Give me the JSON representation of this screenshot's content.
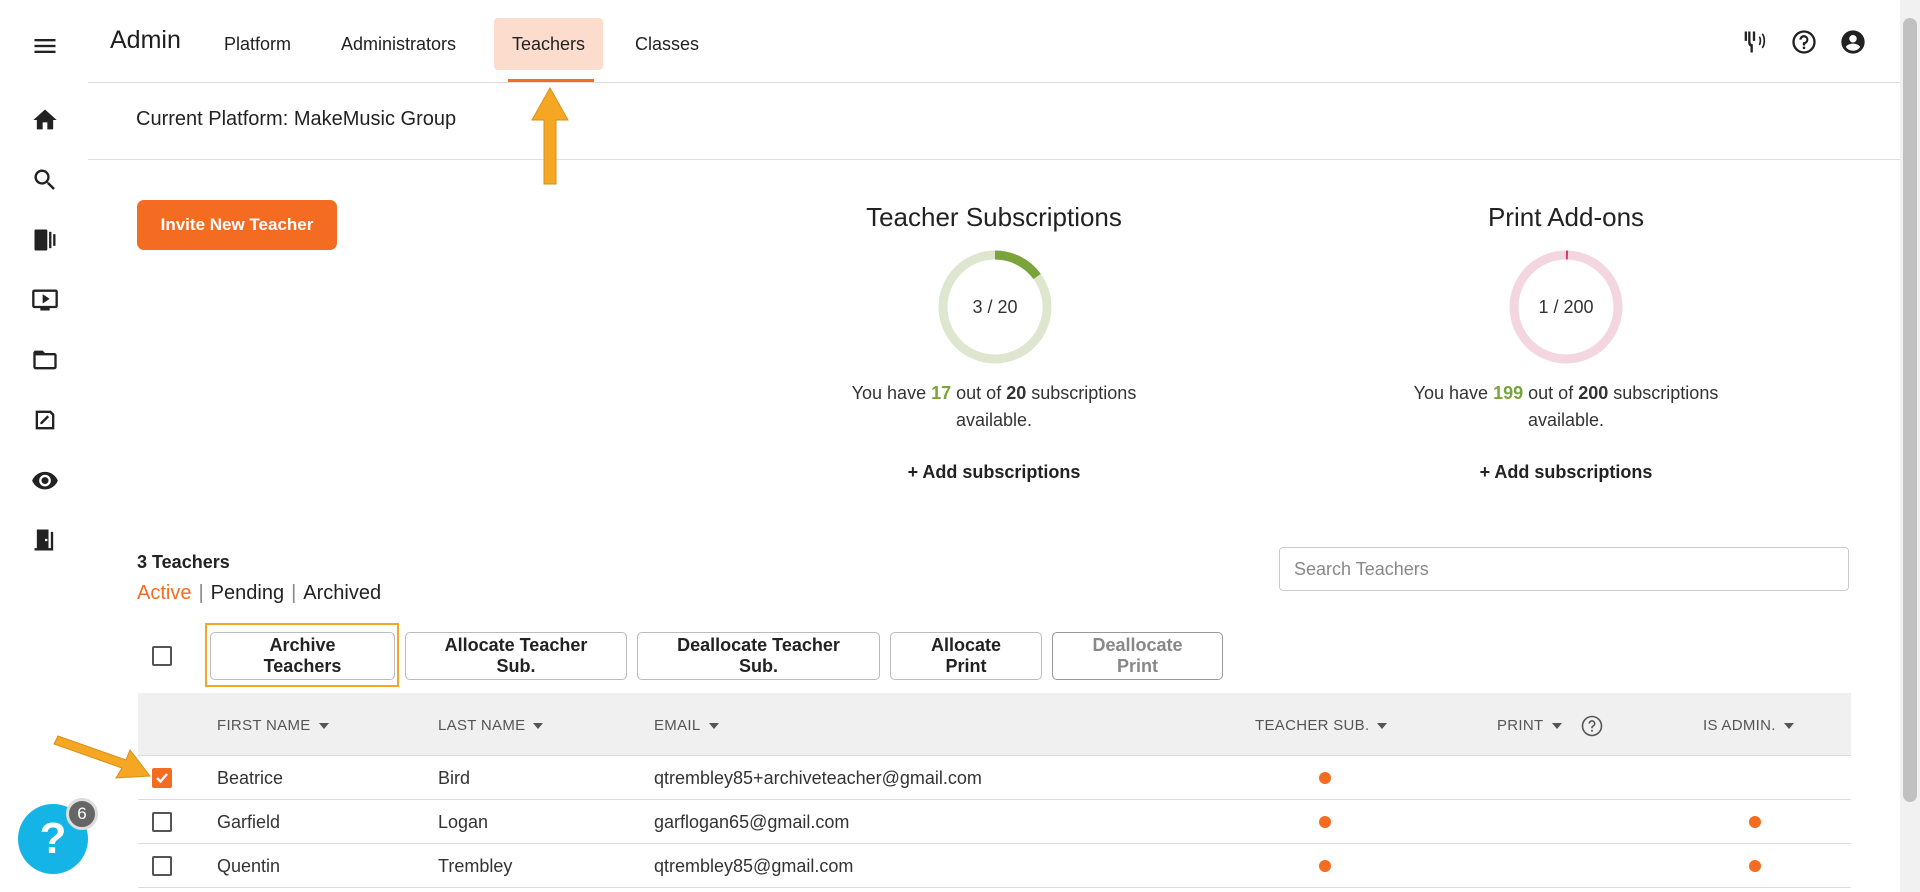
{
  "header": {
    "brand": "Admin",
    "nav": [
      {
        "label": "Platform"
      },
      {
        "label": "Administrators"
      },
      {
        "label": "Teachers",
        "active": true
      },
      {
        "label": "Classes"
      }
    ]
  },
  "platform": {
    "label": "Current Platform: MakeMusic Group"
  },
  "invite_label": "Invite New Teacher",
  "teacher_subscriptions": {
    "title": "Teacher Subscriptions",
    "ring_text": "3 / 20",
    "used": 3,
    "total": 20,
    "desc_prefix": "You have",
    "available": "17",
    "desc_mid": "out of",
    "total_text": "20",
    "desc_suffix": "subscriptions",
    "desc_line2": "available.",
    "add_label": "+ Add subscriptions",
    "color": "#7aa33c"
  },
  "print_addons": {
    "title": "Print Add-ons",
    "ring_text": "1 / 200",
    "used": 1,
    "total": 200,
    "desc_prefix": "You have",
    "available": "199",
    "desc_mid": "out of",
    "total_text": "200",
    "desc_suffix": "subscriptions",
    "desc_line2": "available.",
    "add_label": "+ Add subscriptions",
    "color": "#d63c6b"
  },
  "teachers": {
    "count_label": "3 Teachers",
    "filters": [
      "Active",
      "Pending",
      "Archived"
    ],
    "search_placeholder": "Search Teachers",
    "actions": [
      "Archive Teachers",
      "Allocate Teacher Sub.",
      "Deallocate Teacher Sub.",
      "Allocate Print",
      "Deallocate Print"
    ],
    "columns": [
      "FIRST NAME",
      "LAST NAME",
      "EMAIL",
      "TEACHER SUB.",
      "PRINT",
      "IS ADMIN."
    ],
    "rows": [
      {
        "first": "Beatrice",
        "last": "Bird",
        "email": "qtrembley85+archiveteacher@gmail.com",
        "teacher_sub": true,
        "print": false,
        "is_admin": false,
        "checked": true
      },
      {
        "first": "Garfield",
        "last": "Logan",
        "email": "garflogan65@gmail.com",
        "teacher_sub": true,
        "print": false,
        "is_admin": true,
        "checked": false
      },
      {
        "first": "Quentin",
        "last": "Trembley",
        "email": "qtrembley85@gmail.com",
        "teacher_sub": true,
        "print": false,
        "is_admin": true,
        "checked": false
      }
    ]
  },
  "help": {
    "badge": "6"
  },
  "colors": {
    "accent": "#f36c21",
    "highlight": "#f5a623",
    "help": "#14b4e6"
  }
}
